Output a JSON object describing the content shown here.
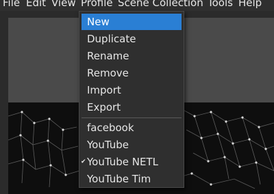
{
  "menubar": {
    "items": [
      "File",
      "Edit",
      "View",
      "Profile",
      "Scene Collection",
      "Tools",
      "Help"
    ]
  },
  "profile_menu": {
    "actions": [
      "New",
      "Duplicate",
      "Rename",
      "Remove",
      "Import",
      "Export"
    ],
    "profiles": [
      "facebook",
      "YouTube",
      "YouTube NETL",
      "YouTube Tim"
    ],
    "checked_profile": "YouTube NETL",
    "highlighted_action": "New"
  },
  "colors": {
    "highlight": "#2a7fd4",
    "menu_bg": "#2f2f2f",
    "preview_gray": "#4a4a4a",
    "preview_dark": "#0e0e0e"
  },
  "icons": {
    "check": "checkmark-icon"
  }
}
